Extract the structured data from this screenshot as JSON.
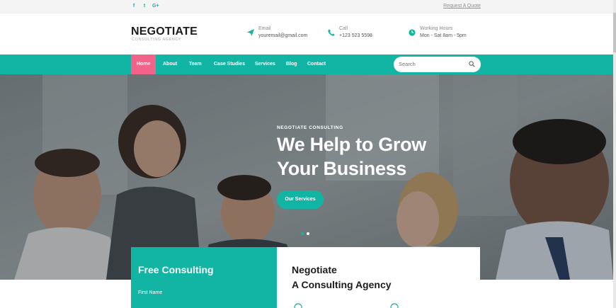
{
  "topbar": {
    "socials": [
      {
        "icon": "facebook-icon",
        "glyph": "f"
      },
      {
        "icon": "twitter-icon",
        "glyph": "t"
      },
      {
        "icon": "google-plus-icon",
        "glyph": "G+"
      }
    ],
    "quote_link": "Request A Quote"
  },
  "brand": {
    "name": "NEGOTIATE",
    "tagline": "CONSULTING AGENCY"
  },
  "contact": {
    "email": {
      "label": "Email",
      "value": "youremail@gmail.com",
      "icon": "paper-plane-icon"
    },
    "call": {
      "label": "Call",
      "value": "+123 523 5598",
      "icon": "phone-icon"
    },
    "hours": {
      "label": "Working Hours",
      "value": "Mon - Sat 8am - 5pm",
      "icon": "clock-icon"
    }
  },
  "nav": {
    "items": [
      "Home",
      "About",
      "Team",
      "Case Studies",
      "Services",
      "Blog",
      "Contact"
    ],
    "active": "Home",
    "search_placeholder": "Search"
  },
  "hero": {
    "subtitle": "NEGOTIATE CONSULTING",
    "title_line1": "We Help to Grow",
    "title_line2": "Your Business",
    "button": "Our Services",
    "slide_count": 2,
    "active_slide": 2
  },
  "consulting": {
    "title": "Free Consulting",
    "field_label": "First Name"
  },
  "about": {
    "line1": "Negotiate",
    "line2": "A Consulting Agency"
  },
  "colors": {
    "accent": "#12b5a4",
    "active_nav": "#f2638a",
    "text_dark": "#1c1c1c"
  }
}
